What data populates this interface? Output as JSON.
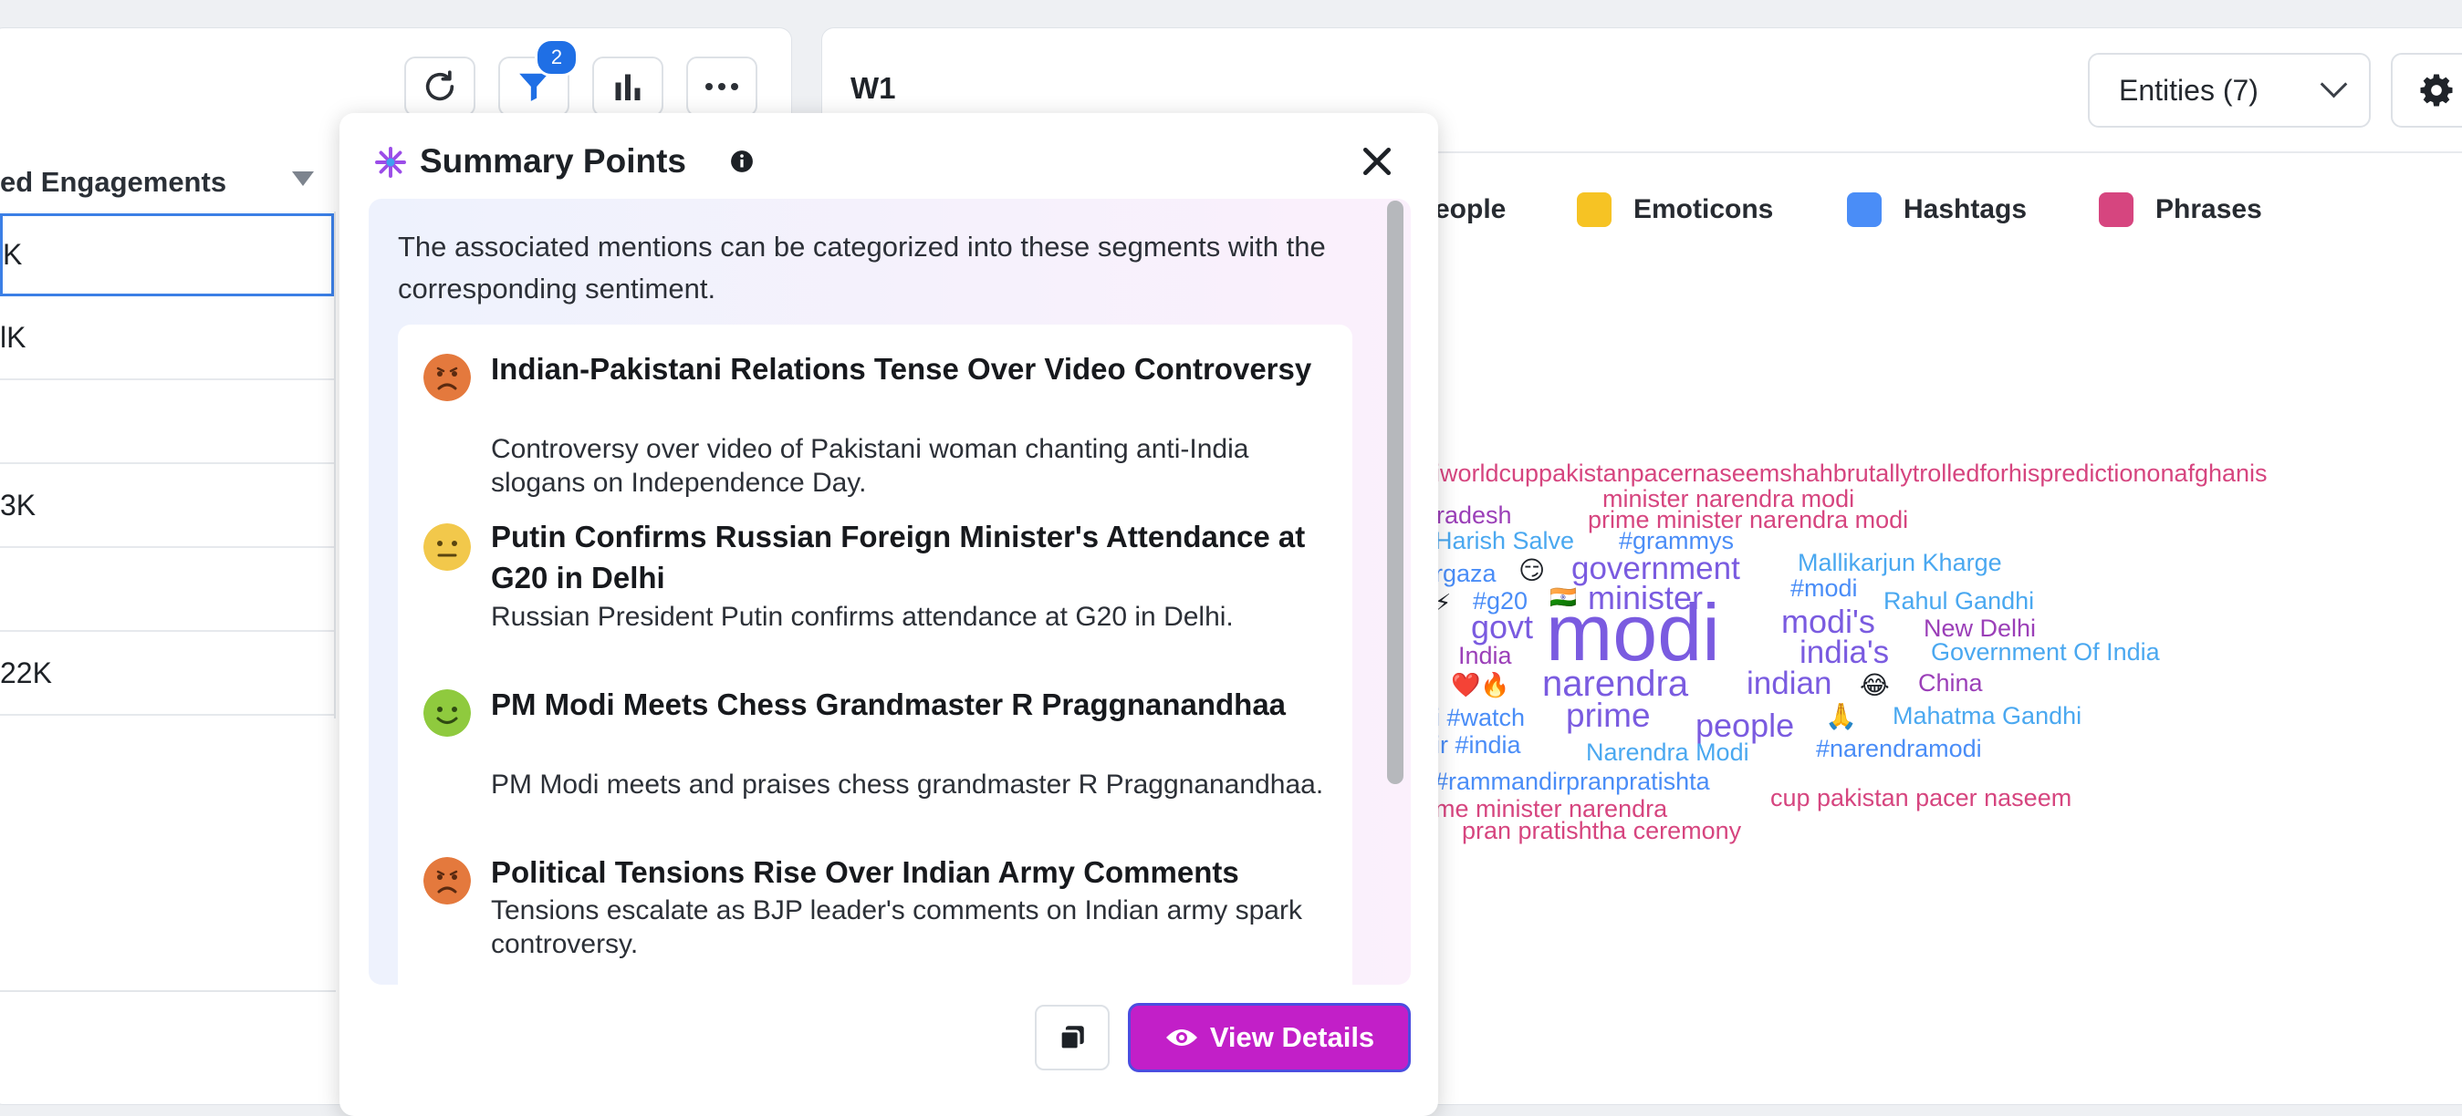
{
  "left_panel": {
    "toolbar": {
      "refresh_icon": "refresh-icon",
      "filter_icon": "filter-icon",
      "filter_badge": "2",
      "chart_icon": "bar-chart-icon",
      "more_icon": "more-horizontal-icon"
    },
    "column_header": "ed Engagements",
    "rows": [
      "K",
      "lK",
      "",
      "3K",
      "",
      "22K"
    ]
  },
  "right_panel": {
    "title": "W1",
    "entities_dropdown": "Entities (7)",
    "legend": [
      {
        "label": "eople",
        "color": ""
      },
      {
        "label": "Emoticons",
        "color": "#f6c324"
      },
      {
        "label": "Hashtags",
        "color": "#4a8df7"
      },
      {
        "label": "Phrases",
        "color": "#d6457f"
      }
    ],
    "colors": {
      "phrases": "#d6457f",
      "hashtags": "#4aa8f0",
      "topics": "#7a5be0",
      "people": "#9b3fb8"
    }
  },
  "word_cloud": {
    "w1": "iworldcuppakistanpacernaseemshahbrutallytrolledforhispredictiononafghanis",
    "w2": "minister narendra modi",
    "w3": "radesh",
    "w4": "prime minister narendra modi",
    "w5": "Harish Salve",
    "w6": "#grammys",
    "w7": "rgaza",
    "w8": "government",
    "w9": "Mallikarjun Kharge",
    "w10": "#modi",
    "w11": "#g20",
    "w12": "minister",
    "w13": "Rahul Gandhi",
    "w14": "govt",
    "w15": "modi",
    "w16": "modi's",
    "w17": "New Delhi",
    "w18": "India",
    "w19": "india's",
    "w20": "Government Of India",
    "w21": "narendra",
    "w22": "indian",
    "w23": "China",
    "w24": "i #watch",
    "w25": "prime",
    "w26": "people",
    "w27": "Mahatma Gandhi",
    "w28": "ir #india",
    "w29": "Narendra Modi",
    "w30": "#narendramodi",
    "w31": "#rammandirpranpratishta",
    "w32": "cup pakistan pacer naseem",
    "w33": "me minister narendra",
    "w34": "pran pratishtha ceremony"
  },
  "modal": {
    "title": "Summary Points",
    "intro": "The associated mentions can be categorized into these segments with the corresponding sentiment.",
    "points": [
      {
        "sentiment": "negative",
        "title": "Indian-Pakistani Relations Tense Over Video Controversy",
        "desc": "Controversy over video of Pakistani woman chanting anti-India slogans on Independence Day."
      },
      {
        "sentiment": "neutral",
        "title": "Putin Confirms Russian Foreign Minister's Attendance at G20 in Delhi",
        "desc": "Russian President Putin confirms attendance at G20 in Delhi."
      },
      {
        "sentiment": "positive",
        "title": "PM Modi Meets Chess Grandmaster R Praggnanandhaa",
        "desc": "PM Modi meets and praises chess grandmaster R Praggnanandhaa."
      },
      {
        "sentiment": "negative",
        "title": "Political Tensions Rise Over Indian Army Comments",
        "desc": "Tensions escalate as BJP leader's comments on Indian army spark controversy."
      }
    ],
    "view_details_label": "View Details"
  }
}
